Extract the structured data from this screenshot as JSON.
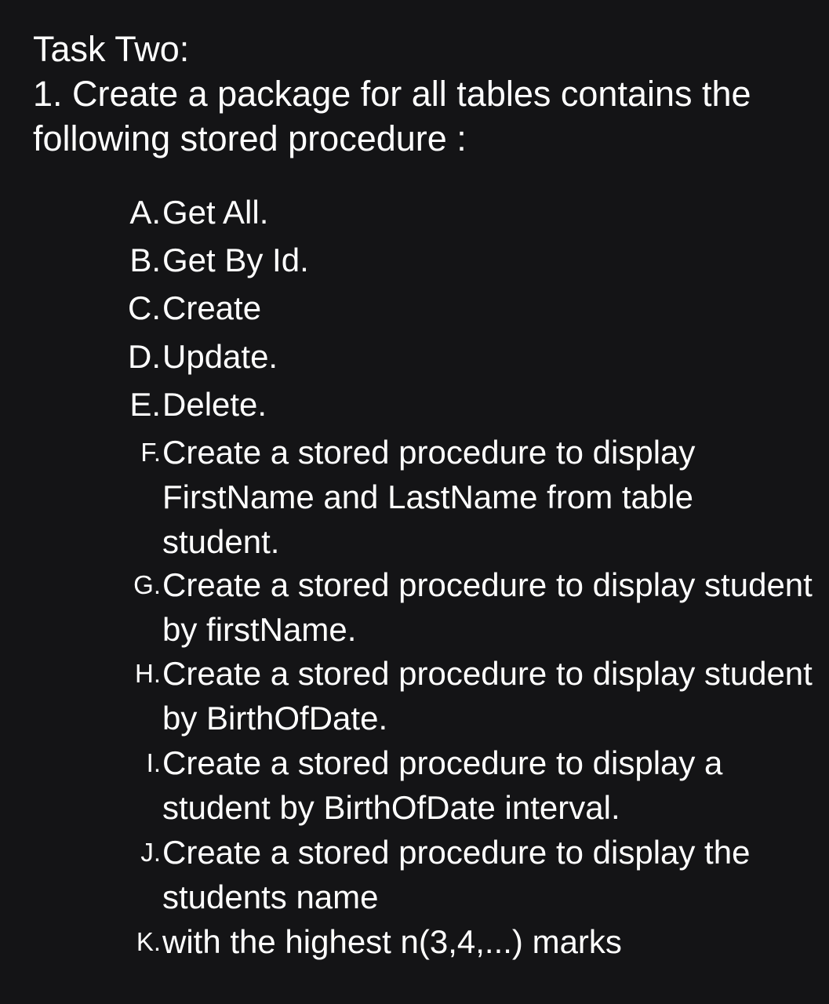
{
  "heading": "Task Two:",
  "intro": "1. Create a package for all tables contains the following stored procedure :",
  "items": [
    {
      "marker": "A.",
      "text": "Get All."
    },
    {
      "marker": "B.",
      "text": "Get By Id."
    },
    {
      "marker": "C.",
      "text": "Create"
    },
    {
      "marker": "D.",
      "text": "Update."
    },
    {
      "marker": "E.",
      "text": "Delete."
    },
    {
      "marker": "F.",
      "text": "Create a stored procedure to display FirstName and LastName from table student."
    },
    {
      "marker": "G.",
      "text": "Create a stored procedure to display student by firstName."
    },
    {
      "marker": "H.",
      "text": "Create a stored procedure to display student by BirthOfDate."
    },
    {
      "marker": "I.",
      "text": "Create a stored procedure to display a student by BirthOfDate interval."
    },
    {
      "marker": "J.",
      "text": "Create a stored procedure to display the students name"
    },
    {
      "marker": "K.",
      "text": "with the highest n(3,4,...) marks"
    }
  ]
}
